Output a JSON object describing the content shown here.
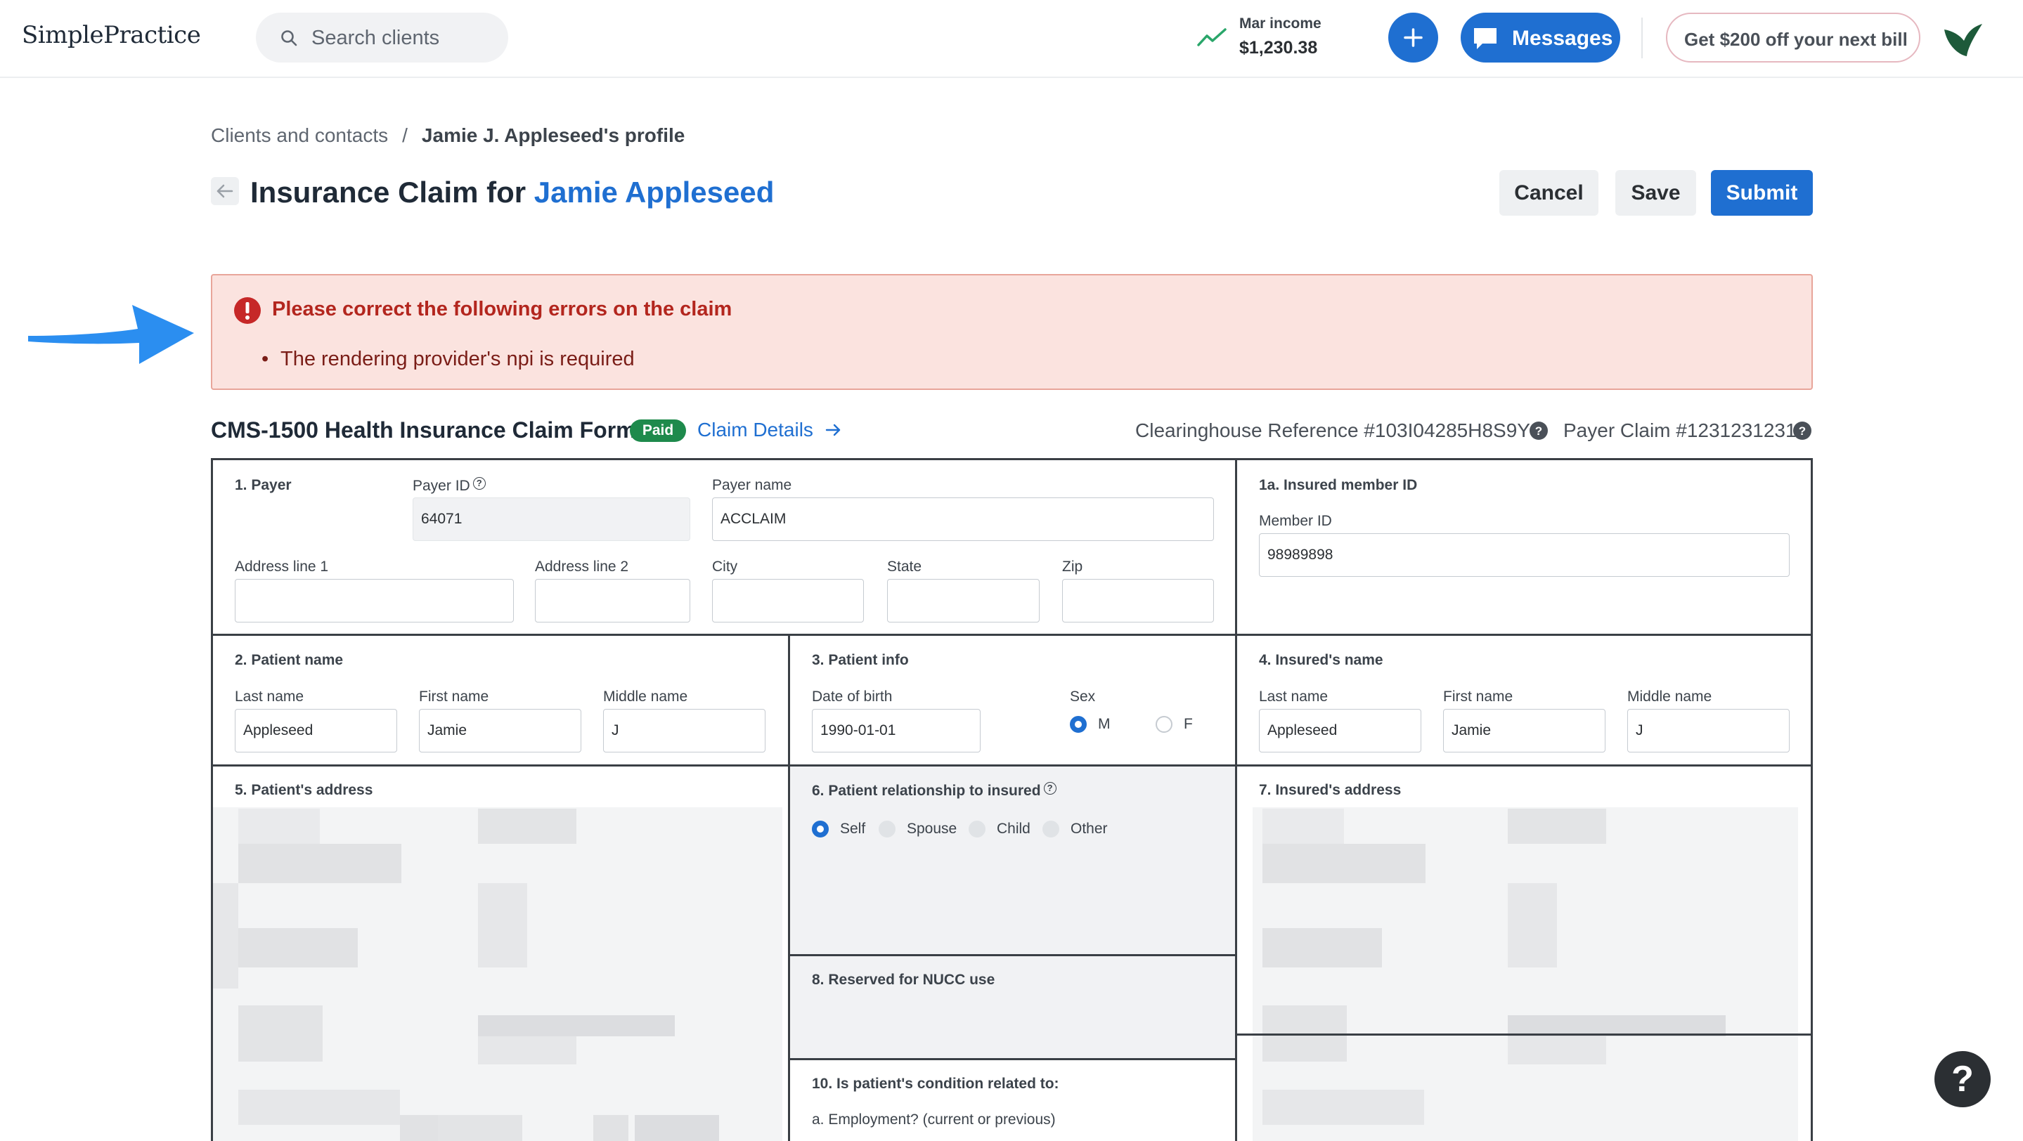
{
  "header": {
    "logo": "SimplePractice",
    "search_placeholder": "Search clients",
    "income_label": "Mar income",
    "income_value": "$1,230.38",
    "messages_label": "Messages",
    "promo_label": "Get $200 off your next bill",
    "accent_color": "#1f6fd1"
  },
  "breadcrumb": {
    "parent": "Clients and contacts",
    "separator": "/",
    "current": "Jamie J. Appleseed's profile"
  },
  "page": {
    "title_prefix": "Insurance Claim for",
    "client_name": "Jamie Appleseed",
    "cancel_label": "Cancel",
    "save_label": "Save",
    "submit_label": "Submit"
  },
  "error": {
    "heading": "Please correct the following errors on the claim",
    "items": [
      "The rendering provider's npi is required"
    ]
  },
  "form_header": {
    "title": "CMS-1500 Health Insurance Claim Form",
    "status_badge": "Paid",
    "claim_details_link": "Claim Details",
    "clearinghouse_ref": "Clearinghouse Reference #103I04285H8S9Y",
    "payer_claim": "Payer Claim #1231231231"
  },
  "form": {
    "payer": {
      "section": "1. Payer",
      "payer_id_label": "Payer ID",
      "payer_id": "64071",
      "payer_name_label": "Payer name",
      "payer_name": "ACCLAIM",
      "address1_label": "Address line 1",
      "address1": "",
      "address2_label": "Address line 2",
      "address2": "",
      "city_label": "City",
      "city": "",
      "state_label": "State",
      "state": "",
      "zip_label": "Zip",
      "zip": ""
    },
    "insured_member": {
      "section": "1a. Insured member ID",
      "member_id_label": "Member ID",
      "member_id": "98989898"
    },
    "patient_name": {
      "section": "2. Patient name",
      "last_label": "Last name",
      "last": "Appleseed",
      "first_label": "First name",
      "first": "Jamie",
      "middle_label": "Middle name",
      "middle": "J"
    },
    "patient_info": {
      "section": "3. Patient info",
      "dob_label": "Date of birth",
      "dob": "1990-01-01",
      "sex_label": "Sex",
      "sex_options": [
        "M",
        "F"
      ],
      "sex_selected": "M"
    },
    "insured_name": {
      "section": "4. Insured's name",
      "last_label": "Last name",
      "last": "Appleseed",
      "first_label": "First name",
      "first": "Jamie",
      "middle_label": "Middle name",
      "middle": "J"
    },
    "patient_address": {
      "section": "5. Patient's address"
    },
    "relationship": {
      "section": "6. Patient relationship to insured",
      "options": [
        "Self",
        "Spouse",
        "Child",
        "Other"
      ],
      "selected": "Self"
    },
    "insured_address": {
      "section": "7. Insured's address"
    },
    "reserved": {
      "section": "8. Reserved for NUCC use"
    },
    "condition": {
      "section": "10. Is patient's condition related to:",
      "employment_label": "a. Employment? (current or previous)"
    }
  },
  "help_label": "?"
}
